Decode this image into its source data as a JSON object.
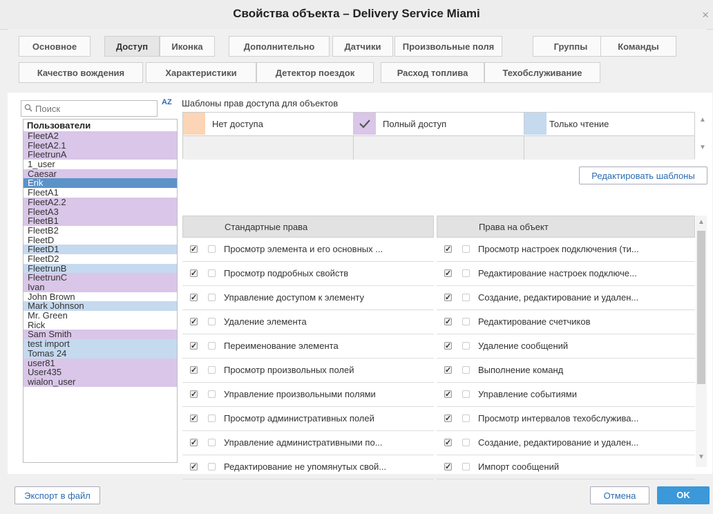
{
  "title": "Свойства объекта – Delivery Service Miami",
  "close_label": "×",
  "tabs_row1": [
    "Основное",
    "Доступ",
    "Иконка",
    "Дополнительно",
    "Датчики",
    "Произвольные поля",
    "Группы",
    "Команды"
  ],
  "tabs_row2": [
    "Качество вождения",
    "Характеристики",
    "Детектор поездок",
    "Расход топлива",
    "Техобслуживание"
  ],
  "search": {
    "placeholder": "Поиск"
  },
  "sort_icon": "sort-az-icon",
  "sort_label": "AZ",
  "users": {
    "header": "Пользователи",
    "items": [
      "FleetA2",
      "FleetA2.1",
      "FleetrunA",
      "1_user",
      "Caesar",
      "Erik",
      "FleetA1",
      "FleetA2.2",
      "FleetA3",
      "FleetB1",
      "FleetB2",
      "FleetD",
      "FleetD1",
      "FleetD2",
      "FleetrunB",
      "FleetrunC",
      "Ivan",
      "John Brown",
      "Mark Johnson",
      "Mr. Green",
      "Rick",
      "Sam Smith",
      "test import",
      "Tomas 24",
      "user81",
      "User435",
      "wialon_user"
    ]
  },
  "templates": {
    "title": "Шаблоны прав доступа для объектов",
    "items": [
      "Нет доступа",
      "Полный доступ",
      "Только чтение"
    ],
    "colors": {
      "no_access": "#fbd5b5",
      "full_access": "#d9c6e8",
      "read_only": "#c5d9ef"
    },
    "edit_button": "Редактировать шаблоны"
  },
  "standard_rights": {
    "header": "Стандартные права",
    "items": [
      "Просмотр элемента и его основных ...",
      "Просмотр подробных свойств",
      "Управление доступом к элементу",
      "Удаление элемента",
      "Переименование элемента",
      "Просмотр произвольных полей",
      "Управление произвольными полями",
      "Просмотр административных полей",
      "Управление административными по...",
      "Редактирование не упомянутых свой..."
    ]
  },
  "object_rights": {
    "header": "Права на объект",
    "items": [
      "Просмотр настроек подключения (ти...",
      "Редактирование настроек подключе...",
      "Создание, редактирование и удален...",
      "Редактирование счетчиков",
      "Удаление сообщений",
      "Выполнение команд",
      "Управление событиями",
      "Просмотр интервалов техобслужива...",
      "Создание, редактирование и удален...",
      "Импорт сообщений"
    ]
  },
  "footer": {
    "export": "Экспорт в файл",
    "cancel": "Отмена",
    "ok": "OK"
  },
  "colors": {
    "accent": "#3b98d9",
    "selected": "#5b92c8"
  }
}
